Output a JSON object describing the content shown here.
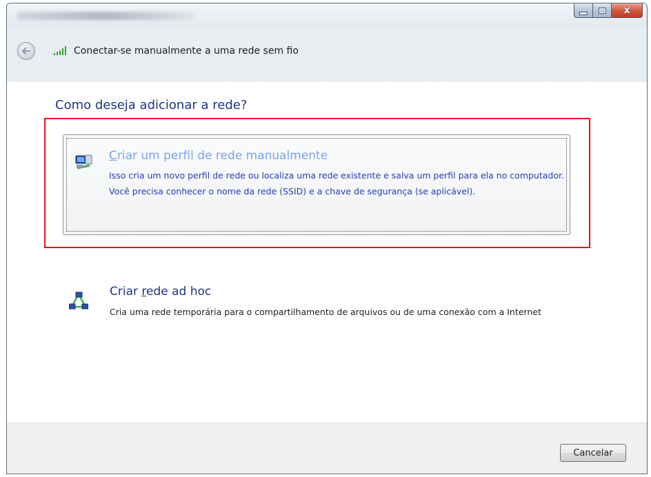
{
  "window": {
    "title": "Conectar-se manualmente a uma rede sem fio",
    "caption_buttons": {
      "minimize": "–",
      "maximize": "□",
      "close": "x"
    }
  },
  "nav": {
    "back_icon": "back-arrow-icon",
    "network_icon": "wifi-signal-icon"
  },
  "main": {
    "heading": "Como deseja adicionar a rede?",
    "options": [
      {
        "icon": "network-profile-icon",
        "title_prefix": "",
        "title_accel": "C",
        "title_rest": "riar um perfil de rede manualmente",
        "description": "Isso cria um novo perfil de rede ou localiza uma rede existente e salva um perfil para ela no computador. Você precisa conhecer o nome da rede (SSID) e a chave de segurança (se aplicável)."
      },
      {
        "icon": "ad-hoc-network-icon",
        "title_prefix": "Criar ",
        "title_accel": "r",
        "title_rest": "ede ad hoc",
        "description": "Cria uma rede temporária para o compartilhamento de arquivos ou de uma conexão com a Internet"
      }
    ]
  },
  "footer": {
    "cancel_label": "Cancelar"
  },
  "colors": {
    "highlight": "#e8101c",
    "heading": "#1e3287",
    "link_hover": "#7aa3e8"
  }
}
